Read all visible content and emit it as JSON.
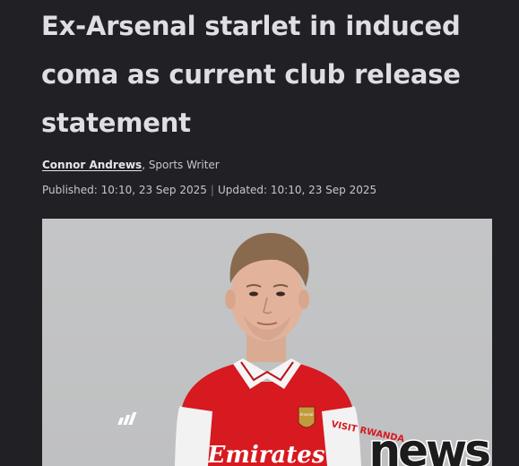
{
  "article": {
    "headline": "Ex-Arsenal starlet in induced coma as current club release statement",
    "author": "Connor Andrews",
    "author_suffix": ", Sports Writer",
    "published": "Published: 10:10, 23 Sep 2025",
    "separator": "|",
    "updated": "Updated: 10:10, 23 Sep 2025"
  },
  "photo": {
    "kit_sponsor": "Emirates",
    "sleeve_text": "VISIT RWANDA",
    "crest_text": "Arsenal",
    "kit_maker": "adidas"
  },
  "watermark": {
    "text": "news"
  },
  "colors": {
    "background": "#202025",
    "headline": "#dedee3",
    "meta_text": "#c6c6cb",
    "shirt_red": "#d71920"
  }
}
